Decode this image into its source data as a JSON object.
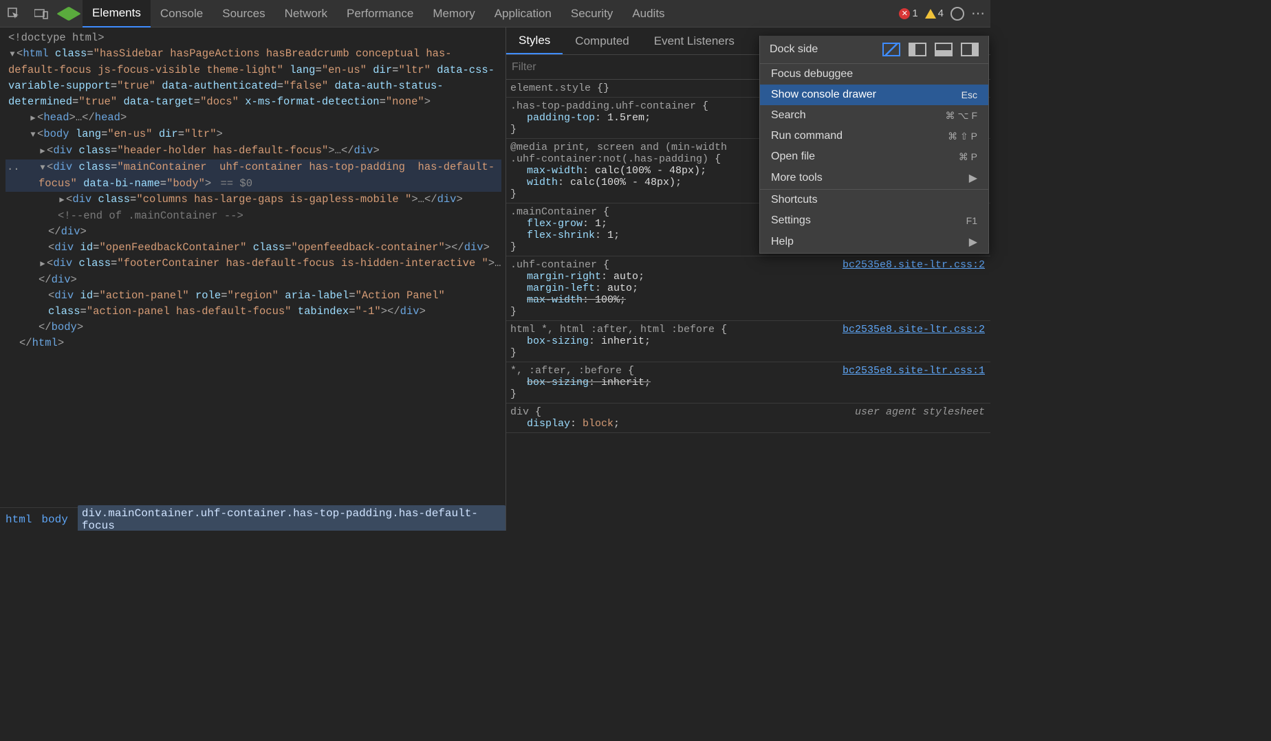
{
  "topbar": {
    "tabs": [
      "Elements",
      "Console",
      "Sources",
      "Network",
      "Performance",
      "Memory",
      "Application",
      "Security",
      "Audits"
    ],
    "active_tab": "Elements",
    "errors": "1",
    "warnings": "4"
  },
  "dom": {
    "lines": [
      {
        "ind": 0,
        "html": "<span class='tagp'>&lt;!doctype html&gt;</span>"
      },
      {
        "ind": 0,
        "html": "<span class='arrow'>▼</span><span class='tagp'>&lt;</span><span class='tagname'>html</span> <span class='attr'>class</span>=<span class='attrv'>\"hasSidebar hasPageActions hasBreadcrumb conceptual has-default-focus js-focus-visible theme-light\"</span> <span class='attr'>lang</span>=<span class='attrv'>\"en-us\"</span> <span class='attr'>dir</span>=<span class='attrv'>\"ltr\"</span> <span class='attr'>data-css-variable-support</span>=<span class='attrv'>\"true\"</span> <span class='attr'>data-authenticated</span>=<span class='attrv'>\"false\"</span> <span class='attr'>data-auth-status-determined</span>=<span class='attrv'>\"true\"</span> <span class='attr'>data-target</span>=<span class='attrv'>\"docs\"</span> <span class='attr'>x-ms-format-detection</span>=<span class='attrv'>\"none\"</span><span class='tagp'>&gt;</span>",
        "wrap": true
      },
      {
        "ind": 2,
        "html": "<span class='arrow'>▶</span><span class='tagp'>&lt;</span><span class='tagname'>head</span><span class='tagp'>&gt;</span><span class='ellips'>…</span><span class='tagp'>&lt;/</span><span class='tagname'>head</span><span class='tagp'>&gt;</span>"
      },
      {
        "ind": 2,
        "html": "<span class='arrow'>▼</span><span class='tagp'>&lt;</span><span class='tagname'>body</span> <span class='attr'>lang</span>=<span class='attrv'>\"en-us\"</span> <span class='attr'>dir</span>=<span class='attrv'>\"ltr\"</span><span class='tagp'>&gt;</span>"
      },
      {
        "ind": 3,
        "html": "<span class='arrow'>▶</span><span class='tagp'>&lt;</span><span class='tagname'>div</span> <span class='attr'>class</span>=<span class='attrv'>\"header-holder has-default-focus\"</span><span class='tagp'>&gt;</span><span class='ellips'>…</span><span class='tagp'>&lt;/</span><span class='tagname'>div</span><span class='tagp'>&gt;</span>"
      },
      {
        "ind": 3,
        "html": "<span class='arrow'>▼</span><span class='tagp'>&lt;</span><span class='tagname'>div</span> <span class='attr'>class</span>=<span class='attrv'>\"mainContainer  uhf-container has-top-padding  has-default-focus\"</span> <span class='attr'>data-bi-name</span>=<span class='attrv'>\"body\"</span><span class='tagp'>&gt;</span><span class='selmark'> == $0</span>",
        "sel": true,
        "dots": true,
        "wrap": true
      },
      {
        "ind": 5,
        "html": "<span class='arrow'>▶</span><span class='tagp'>&lt;</span><span class='tagname'>div</span> <span class='attr'>class</span>=<span class='attrv'>\"columns has-large-gaps is-gapless-mobile \"</span><span class='tagp'>&gt;</span><span class='ellips'>…</span><span class='tagp'>&lt;/</span><span class='tagname'>div</span><span class='tagp'>&gt;</span>"
      },
      {
        "ind": 5,
        "html": "<span class='comment'>&lt;!--end of .mainContainer --&gt;</span>"
      },
      {
        "ind": 4,
        "html": "<span class='tagp'>&lt;/</span><span class='tagname'>div</span><span class='tagp'>&gt;</span>"
      },
      {
        "ind": 4,
        "html": "<span class='tagp'>&lt;</span><span class='tagname'>div</span> <span class='attr'>id</span>=<span class='attrv'>\"openFeedbackContainer\"</span> <span class='attr'>class</span>=<span class='attrv'>\"openfeedback-container\"</span><span class='tagp'>&gt;&lt;/</span><span class='tagname'>div</span><span class='tagp'>&gt;</span>",
        "wrap": true
      },
      {
        "ind": 3,
        "html": "<span class='arrow'>▶</span><span class='tagp'>&lt;</span><span class='tagname'>div</span> <span class='attr'>class</span>=<span class='attrv'>\"footerContainer has-default-focus is-hidden-interactive \"</span><span class='tagp'>&gt;</span><span class='ellips'>…</span><span class='tagp'>&lt;/</span><span class='tagname'>div</span><span class='tagp'>&gt;</span>",
        "wrap": true
      },
      {
        "ind": 4,
        "html": "<span class='tagp'>&lt;</span><span class='tagname'>div</span> <span class='attr'>id</span>=<span class='attrv'>\"action-panel\"</span> <span class='attr'>role</span>=<span class='attrv'>\"region\"</span> <span class='attr'>aria-label</span>=<span class='attrv'>\"Action Panel\"</span> <span class='attr'>class</span>=<span class='attrv'>\"action-panel has-default-focus\"</span> <span class='attr'>tabindex</span>=<span class='attrv'>\"-1\"</span><span class='tagp'>&gt;&lt;/</span><span class='tagname'>div</span><span class='tagp'>&gt;</span>",
        "wrap": true
      },
      {
        "ind": 3,
        "html": "<span class='tagp'>&lt;/</span><span class='tagname'>body</span><span class='tagp'>&gt;</span>"
      },
      {
        "ind": 1,
        "html": "<span class='tagp'>&lt;/</span><span class='tagname'>html</span><span class='tagp'>&gt;</span>"
      }
    ]
  },
  "breadcrumb": [
    "html",
    "body",
    "div.mainContainer.uhf-container.has-top-padding.has-default-focus"
  ],
  "styles": {
    "subtabs": [
      "Styles",
      "Computed",
      "Event Listeners"
    ],
    "active_subtab": "Styles",
    "filter_placeholder": "Filter",
    "rules": [
      {
        "selector": "element.style",
        "decls": []
      },
      {
        "selector": ".has-top-padding.uhf-container",
        "decls": [
          {
            "p": "padding-top",
            "v": "1.5rem"
          }
        ]
      },
      {
        "selector": "@media print, screen and (min-width",
        "mediahead": true,
        "decls": [],
        "cont": {
          "selector": ".uhf-container:not(.has-padding)",
          "decls": [
            {
              "p": "max-width",
              "v": "calc(100% - 48px)"
            },
            {
              "p": "width",
              "v": "calc(100% - 48px)"
            }
          ]
        }
      },
      {
        "selector": ".mainContainer",
        "decls": [
          {
            "p": "flex-grow",
            "v": "1"
          },
          {
            "p": "flex-shrink",
            "v": "1"
          }
        ]
      },
      {
        "selector": ".uhf-container",
        "src": "bc2535e8.site-ltr.css:2",
        "decls": [
          {
            "p": "margin-right",
            "v": "auto"
          },
          {
            "p": "margin-left",
            "v": "auto"
          },
          {
            "p": "max-width",
            "v": "100%",
            "strike": true
          }
        ]
      },
      {
        "selector": "html *, html :after, html :before",
        "src": "bc2535e8.site-ltr.css:2",
        "decls": [
          {
            "p": "box-sizing",
            "v": "inherit"
          }
        ]
      },
      {
        "selector": "*, :after, :before",
        "src": "bc2535e8.site-ltr.css:1",
        "decls": [
          {
            "p": "box-sizing",
            "v": "inherit",
            "strike": true
          }
        ]
      },
      {
        "selector": "div",
        "uas": "user agent stylesheet",
        "decls": [
          {
            "p": "display",
            "v": "block",
            "open": true
          }
        ]
      }
    ]
  },
  "popup": {
    "dock_label": "Dock side",
    "items": [
      {
        "label": "Focus debuggee"
      },
      {
        "label": "Show console drawer",
        "sc": "Esc",
        "hl": true
      },
      {
        "label": "Search",
        "sc": "⌘ ⌥ F"
      },
      {
        "label": "Run command",
        "sc": "⌘ ⇧ P"
      },
      {
        "label": "Open file",
        "sc": "⌘ P"
      },
      {
        "label": "More tools",
        "sub": true
      },
      {
        "sep": true
      },
      {
        "label": "Shortcuts"
      },
      {
        "label": "Settings",
        "sc": "F1"
      },
      {
        "label": "Help",
        "sub": true
      }
    ]
  }
}
